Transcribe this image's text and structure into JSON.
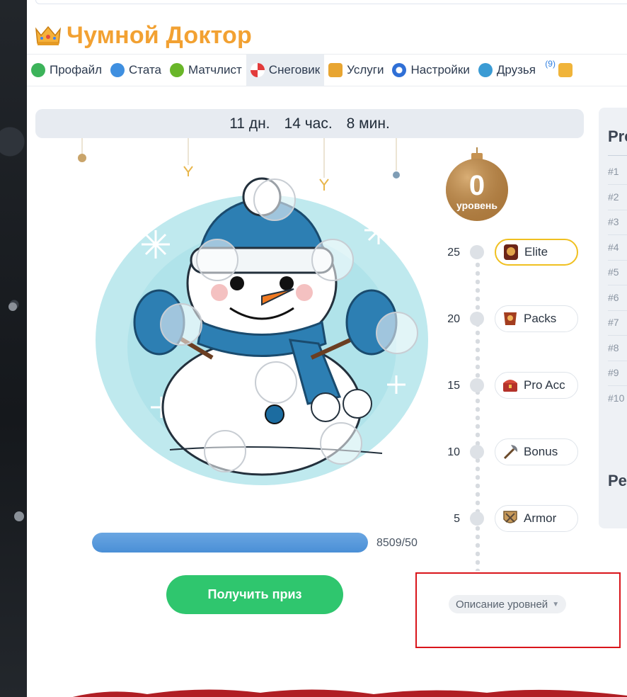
{
  "header": {
    "title": "Чумной Доктор"
  },
  "nav": {
    "items": [
      {
        "label": "Профайл",
        "icon": "profile-icon",
        "color": "#3cb35a"
      },
      {
        "label": "Стата",
        "icon": "stats-icon",
        "color": "#3f8fe0"
      },
      {
        "label": "Матчлист",
        "icon": "matchlist-icon",
        "color": "#69b629"
      },
      {
        "label": "Снеговик",
        "icon": "peppermint-icon",
        "color": "#e23b3b",
        "active": true
      },
      {
        "label": "Услуги",
        "icon": "services-icon",
        "color": "#e8a531"
      },
      {
        "label": "Настройки",
        "icon": "settings-icon",
        "color": "#2f6fd6"
      },
      {
        "label": "Друзья",
        "icon": "friends-icon",
        "color": "#3a9bd4",
        "badge": "(9)"
      }
    ]
  },
  "event": {
    "timer": {
      "days": "11 дн.",
      "hours": "14 час.",
      "minutes": "8 мин."
    },
    "level": {
      "value": "0",
      "caption": "уровень"
    },
    "progress": {
      "text": "8509/50",
      "fraction": 1.0
    },
    "prize_button": "Получить приз",
    "description_toggle": "Описание уровней",
    "rewards": [
      {
        "level": "25",
        "label": "Elite",
        "icon": "elite-icon",
        "highlight": true
      },
      {
        "level": "20",
        "label": "Packs",
        "icon": "packs-icon"
      },
      {
        "level": "15",
        "label": "Pro Acc",
        "icon": "chest-icon"
      },
      {
        "level": "10",
        "label": "Bonus",
        "icon": "axe-icon"
      },
      {
        "level": "5",
        "label": "Armor",
        "icon": "armor-icon"
      }
    ]
  },
  "sidebar": {
    "title": "Pre",
    "ranks": [
      "#1",
      "#2",
      "#3",
      "#4",
      "#5",
      "#6",
      "#7",
      "#8",
      "#9",
      "#10"
    ],
    "title2": "Pe"
  },
  "colors": {
    "accent_orange": "#f2a132",
    "button_green": "#2fc66e",
    "progress_blue": "#4a8fd6",
    "highlight_red": "#d9151b"
  }
}
